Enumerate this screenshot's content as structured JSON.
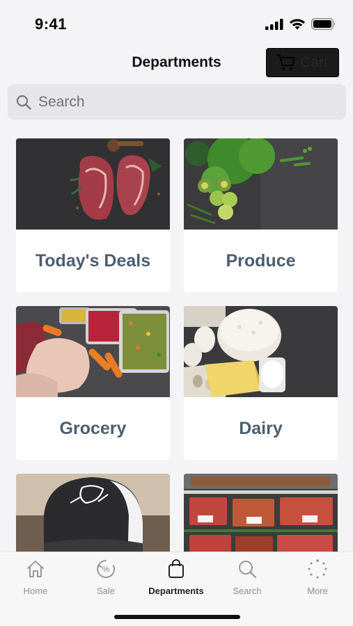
{
  "status": {
    "time": "9:41",
    "icons": [
      "signal-icon",
      "wifi-icon",
      "battery-icon"
    ]
  },
  "header": {
    "title": "Departments",
    "cart_label": "Cart",
    "cart_icon": "cart-icon"
  },
  "search": {
    "placeholder": "Search",
    "value": "",
    "icon": "search-icon"
  },
  "departments": [
    {
      "label": "Today's Deals",
      "photo": "raw steaks on slate"
    },
    {
      "label": "Produce",
      "photo": "green vegetables and kiwi"
    },
    {
      "label": "Grocery",
      "photo": "raw meat and frozen vegetables"
    },
    {
      "label": "Dairy",
      "photo": "cottage cheese, eggs and cheese"
    },
    {
      "label": "",
      "photo": "The Butchers Club trucker cap"
    },
    {
      "label": "",
      "photo": "meat display case"
    }
  ],
  "tabs": [
    {
      "label": "Home",
      "icon": "home-icon",
      "active": false
    },
    {
      "label": "Sale",
      "icon": "sale-percent-icon",
      "active": false
    },
    {
      "label": "Departments",
      "icon": "shopping-bag-icon",
      "active": true
    },
    {
      "label": "Search",
      "icon": "search-icon",
      "active": false
    },
    {
      "label": "More",
      "icon": "more-dots-icon",
      "active": false
    }
  ],
  "colors": {
    "accent_text": "#4d5d70",
    "background": "#f4f4f6",
    "cart_button": "#1b1b1b",
    "tab_inactive": "#8e8e93"
  }
}
